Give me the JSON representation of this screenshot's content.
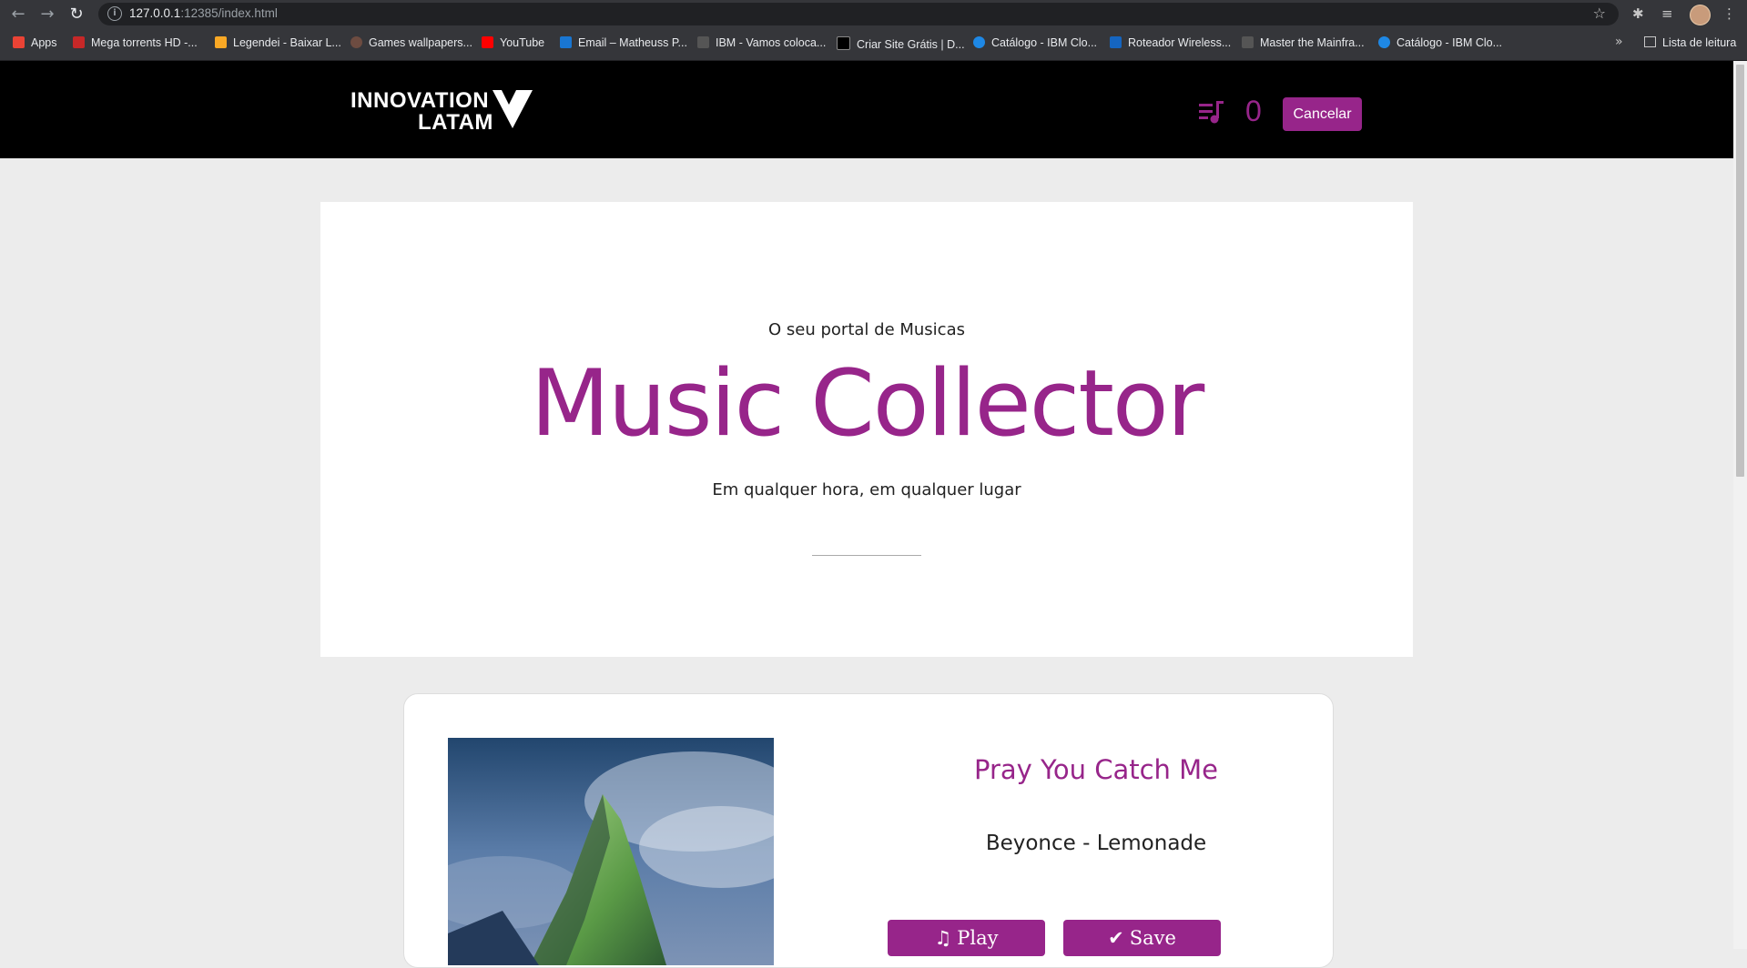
{
  "browser": {
    "url_host": "127.0.0.1",
    "url_path": ":12385/index.html",
    "bookmarks": [
      {
        "label": "Apps",
        "color": "#ea4335"
      },
      {
        "label": "Mega torrents HD -...",
        "color": "#c62828"
      },
      {
        "label": "Legendei - Baixar L...",
        "color": "#f9a825"
      },
      {
        "label": "Games wallpapers...",
        "color": "#6d4c41"
      },
      {
        "label": "YouTube",
        "color": "#ff0000"
      },
      {
        "label": "Email – Matheuss P...",
        "color": "#1976d2"
      },
      {
        "label": "IBM - Vamos coloca...",
        "color": "#555555"
      },
      {
        "label": "Criar Site Grátis | D...",
        "color": "#000000"
      },
      {
        "label": "Catálogo - IBM Clo...",
        "color": "#1e88e5"
      },
      {
        "label": "Roteador Wireless...",
        "color": "#1565c0"
      },
      {
        "label": "Master the Mainfra...",
        "color": "#555555"
      },
      {
        "label": "Catálogo - IBM Clo...",
        "color": "#1e88e5"
      }
    ],
    "reading_list": "Lista de leitura"
  },
  "header": {
    "logo_line1": "INNOVATION",
    "logo_line2": "LATAM",
    "queue_count": "0",
    "cancel_label": "Cancelar",
    "accent": "#97258a"
  },
  "hero": {
    "subtitle": "O seu portal de Musicas",
    "title": "Music Collector",
    "tagline": "Em qualquer hora, em qualquer lugar"
  },
  "songs": [
    {
      "title": "Pray You Catch Me",
      "artist": "Beyonce - Lemonade",
      "play_label": "Play",
      "save_label": "Save",
      "play_icon": "music-note-icon",
      "save_icon": "check-icon"
    }
  ]
}
